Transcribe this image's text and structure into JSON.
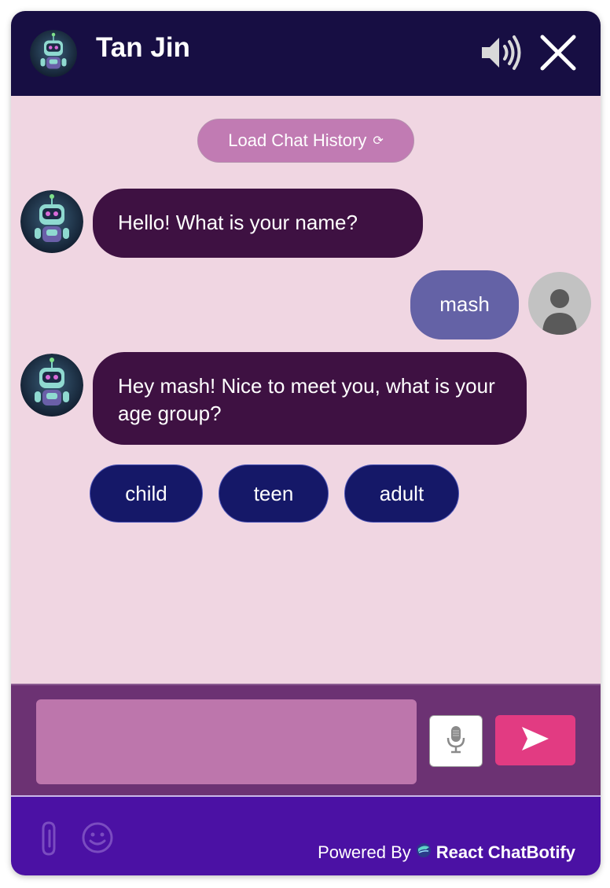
{
  "header": {
    "title": "Tan Jin",
    "bot_avatar_icon": "robot-avatar-icon",
    "audio_icon": "speaker-icon",
    "close_icon": "close-icon"
  },
  "chat": {
    "history_button_label": "Load Chat History",
    "history_button_icon": "⟳",
    "messages": [
      {
        "sender": "bot",
        "text": "Hello! What is your name?"
      },
      {
        "sender": "user",
        "text": "mash"
      },
      {
        "sender": "bot",
        "text": "Hey mash! Nice to meet you, what is your age group?"
      }
    ],
    "options": [
      "child",
      "teen",
      "adult"
    ]
  },
  "input": {
    "value": "",
    "placeholder": "",
    "mic_icon": "microphone-icon",
    "send_icon": "send-icon"
  },
  "footer": {
    "attach_icon": "paperclip-icon",
    "emoji_icon": "smiley-icon",
    "powered_by_label": "Powered By",
    "brand_name": "React ChatBotify"
  },
  "colors": {
    "header_bg": "#170e43",
    "body_bg": "#f0d6e2",
    "bot_bubble": "#3e1142",
    "user_bubble": "#6462a6",
    "option_bg": "#151868",
    "history_button": "#c17bb3",
    "input_area_bg": "#6c3273",
    "input_bg": "#bd76ac",
    "send_button": "#e23b82",
    "footer_bg": "#4b11a4"
  }
}
